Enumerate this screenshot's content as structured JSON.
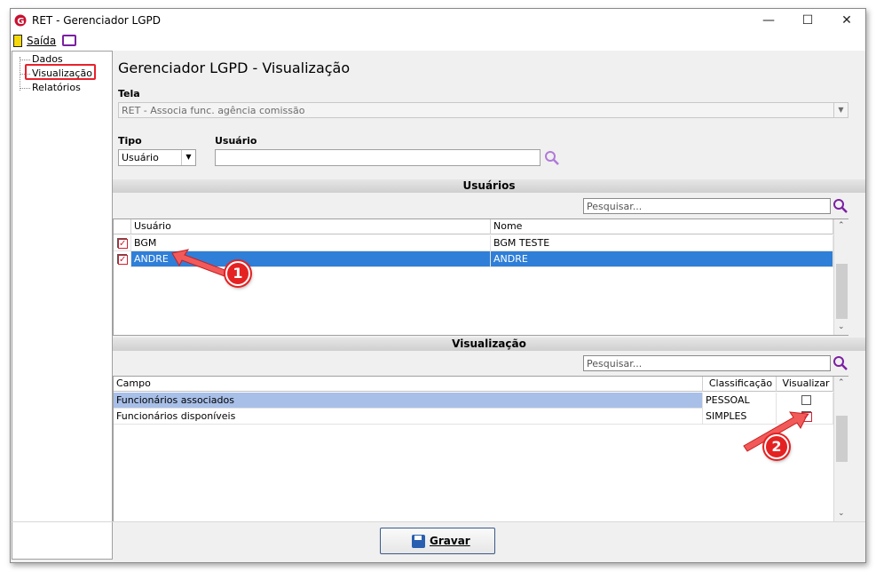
{
  "window": {
    "title": "RET - Gerenciador LGPD",
    "minimize_glyph": "—",
    "maximize_glyph": "☐",
    "close_glyph": "✕"
  },
  "menubar": {
    "exit_label": "Saída",
    "exit_icon": "door-exit-icon",
    "screen_icon": "monitor-icon"
  },
  "tree": {
    "items": [
      "Dados",
      "Visualização",
      "Relatórios"
    ],
    "highlighted": "Visualização",
    "highlight_color": "#e8212b"
  },
  "main": {
    "title": "Gerenciador LGPD - Visualização",
    "tela_label": "Tela",
    "tela_value": "RET - Associa func. agência comissão",
    "tipo_label": "Tipo",
    "tipo_value": "Usuário",
    "usuario_label": "Usuário",
    "usuario_value": ""
  },
  "usuarios": {
    "section_title": "Usuários",
    "search_placeholder": "Pesquisar...",
    "columns": [
      "Usuário",
      "Nome"
    ],
    "rows": [
      {
        "checked": true,
        "usuario": "BGM",
        "nome": "BGM TESTE",
        "selected": false
      },
      {
        "checked": true,
        "usuario": "ANDRE",
        "nome": "ANDRE",
        "selected": true
      }
    ]
  },
  "visualizacao": {
    "section_title": "Visualização",
    "search_placeholder": "Pesquisar...",
    "columns": [
      "Campo",
      "Classificação",
      "Visualizar"
    ],
    "rows": [
      {
        "campo": "Funcionários associados",
        "classificacao": "PESSOAL",
        "visualizar": false,
        "selected": true
      },
      {
        "campo": "Funcionários disponíveis",
        "classificacao": "SIMPLES",
        "visualizar": true,
        "selected": false
      }
    ]
  },
  "annotations": {
    "badge1": "1",
    "badge2": "2",
    "badge_color": "#e52222"
  },
  "footer": {
    "save_label": "Gravar",
    "save_icon": "floppy-disk-icon"
  },
  "colors": {
    "selection": "#2f7fd8",
    "selection_secondary": "#a8bfe8",
    "accent_purple": "#7b1fa2"
  }
}
